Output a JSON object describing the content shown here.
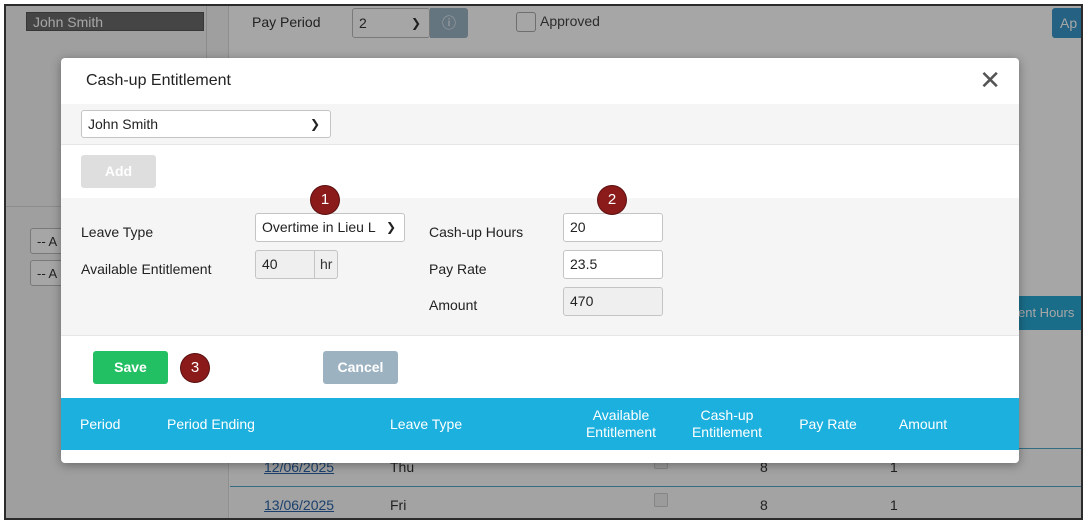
{
  "background": {
    "employee_name": "John Smith",
    "pay_period_label": "Pay Period",
    "pay_period_value": "2",
    "approved_label": "Approved",
    "approve_button_label": "Ap",
    "filter_1": "-- A",
    "filter_2": "-- A",
    "right_header_label": "ent Hours",
    "rows": [
      {
        "date": "12/06/2025",
        "day": "Thu",
        "hours": "8",
        "amount": "1"
      },
      {
        "date": "13/06/2025",
        "day": "Fri",
        "hours": "8",
        "amount": "1"
      }
    ]
  },
  "modal": {
    "title": "Cash-up Entitlement",
    "close_glyph": "✕",
    "employee_select_value": "John Smith",
    "add_label": "Add",
    "form": {
      "leave_type_label": "Leave Type",
      "leave_type_value": "Overtime in Lieu L",
      "available_entitlement_label": "Available Entitlement",
      "available_entitlement_value": "40",
      "available_entitlement_unit": "hr",
      "cashup_hours_label": "Cash-up Hours",
      "cashup_hours_value": "20",
      "pay_rate_label": "Pay Rate",
      "pay_rate_value": "23.5",
      "amount_label": "Amount",
      "amount_value": "470"
    },
    "save_label": "Save",
    "cancel_label": "Cancel",
    "table_headers": {
      "period": "Period",
      "period_ending": "Period Ending",
      "leave_type": "Leave Type",
      "available_entitlement_1": "Available",
      "available_entitlement_2": "Entitlement",
      "cashup_entitlement_1": "Cash-up",
      "cashup_entitlement_2": "Entitlement",
      "pay_rate": "Pay Rate",
      "amount": "Amount"
    }
  },
  "markers": [
    "1",
    "2",
    "3"
  ],
  "colors": {
    "save_green": "#23c063",
    "cancel_grey_blue": "#9cb2c1",
    "header_blue": "#1cb0de",
    "marker_red": "#8b1a1a"
  }
}
